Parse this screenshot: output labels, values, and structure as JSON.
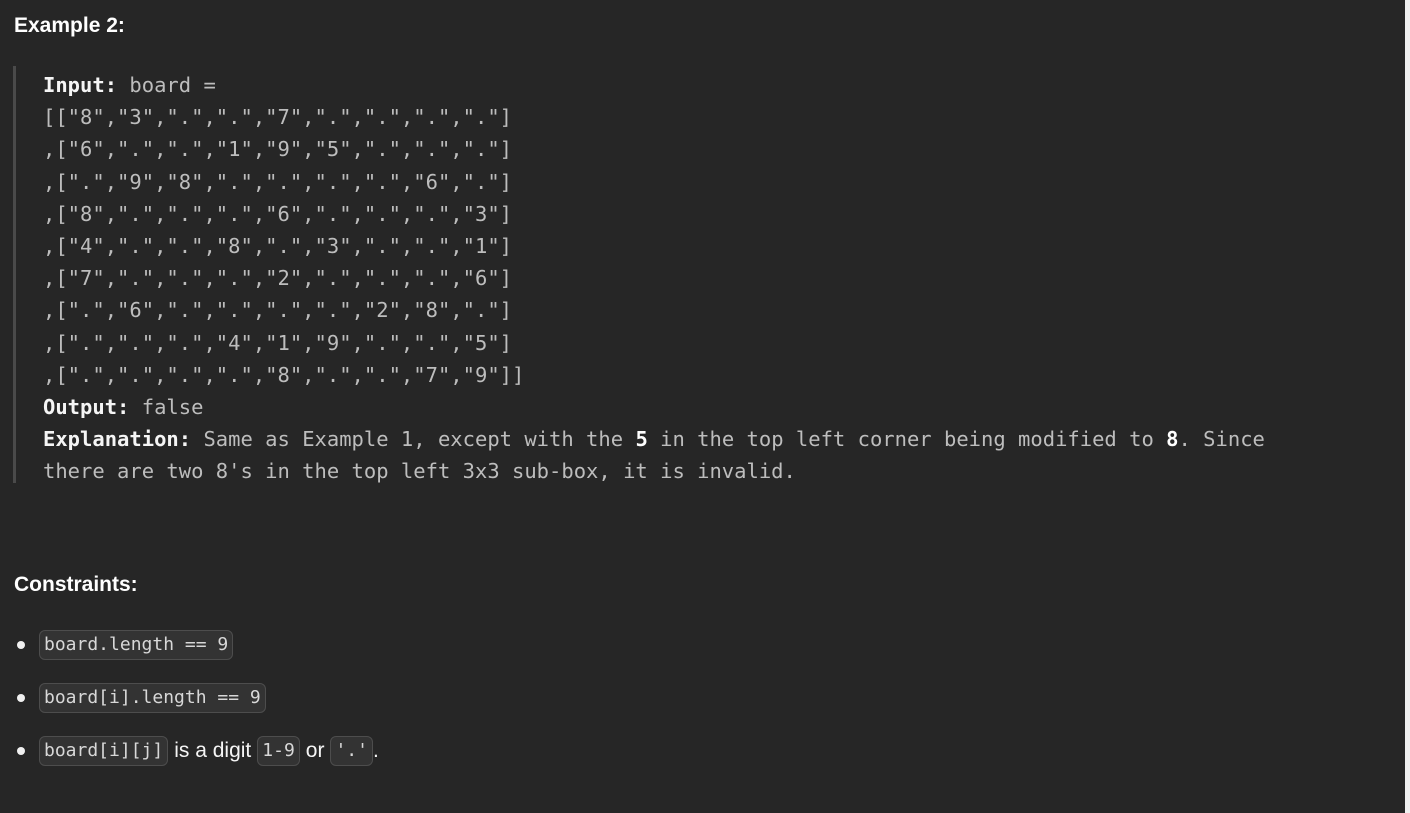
{
  "example": {
    "heading": "Example 2:",
    "input_label": "Input:",
    "input_prefix": " board =",
    "board_lines": [
      "[[\"8\",\"3\",\".\",\".\",\"7\",\".\",\".\",\".\",\".\"]",
      ",[\"6\",\".\",\".\",\"1\",\"9\",\"5\",\".\",\".\",\".\"]",
      ",[\".\",\"9\",\"8\",\".\",\".\",\".\",\".\",\"6\",\".\"]",
      ",[\"8\",\".\",\".\",\".\",\"6\",\".\",\".\",\".\",\"3\"]",
      ",[\"4\",\".\",\".\",\"8\",\".\",\"3\",\".\",\".\",\"1\"]",
      ",[\"7\",\".\",\".\",\".\",\"2\",\".\",\".\",\".\",\"6\"]",
      ",[\".\",\"6\",\".\",\".\",\".\",\".\",\"2\",\"8\",\".\"]",
      ",[\".\",\".\",\".\",\"4\",\"1\",\"9\",\".\",\".\",\"5\"]",
      ",[\".\",\".\",\".\",\".\",\"8\",\".\",\".\",\"7\",\"9\"]]"
    ],
    "output_label": "Output:",
    "output_value": " false",
    "explanation_label": "Explanation:",
    "explanation_part1": " Same as Example 1, except with the ",
    "explanation_bold1": "5",
    "explanation_part2": " in the top left corner being modified to ",
    "explanation_bold2": "8",
    "explanation_part3": ". Since",
    "explanation_line2": "there are two 8's in the top left 3x3 sub-box, it is invalid."
  },
  "constraints": {
    "heading": "Constraints:",
    "items": [
      {
        "code1": "board.length == 9"
      },
      {
        "code1": "board[i].length == 9"
      },
      {
        "code1": "board[i][j]",
        "text1": "is a digit",
        "code2": "1-9",
        "text2": "or",
        "code3": "'.'",
        "text3": "."
      }
    ]
  }
}
